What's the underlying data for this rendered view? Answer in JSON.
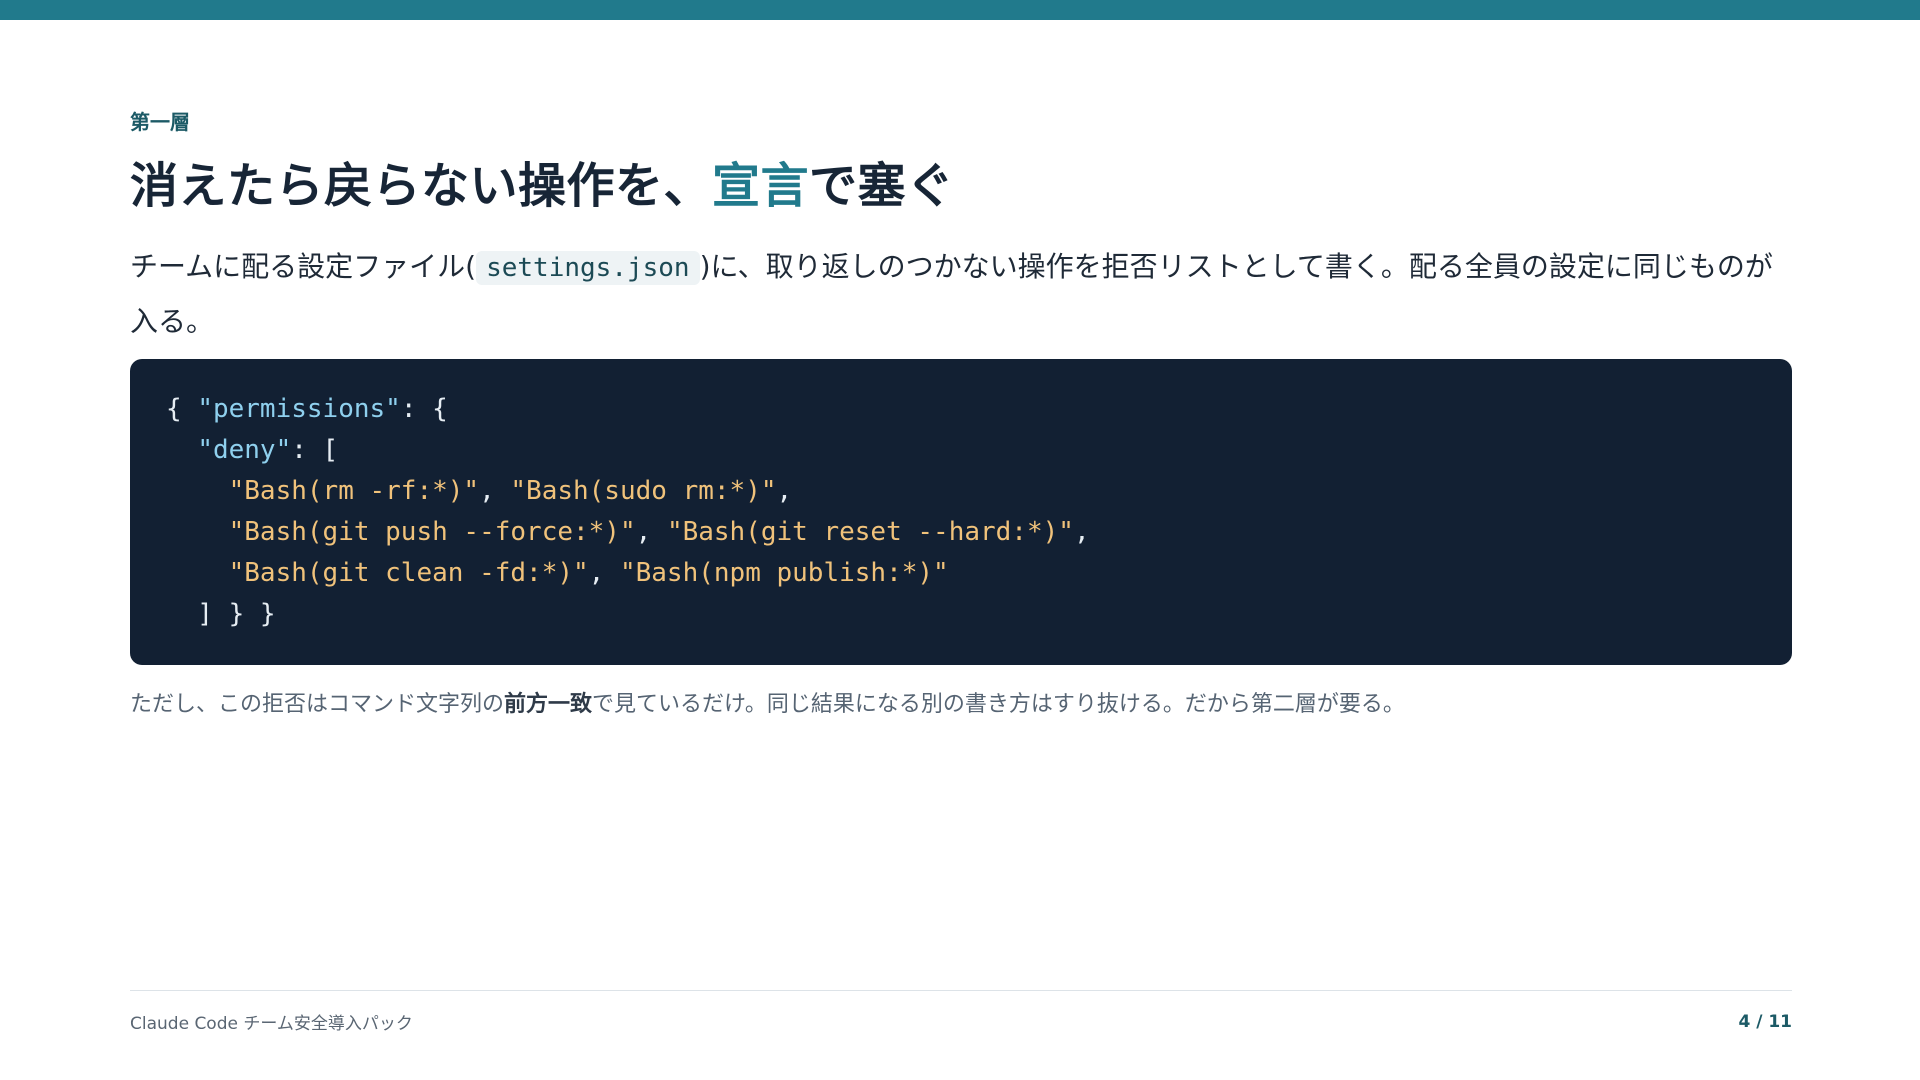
{
  "accent_color": "#217a8c",
  "slide": {
    "eyebrow": "第一層",
    "title_before": "消えたら戻らない操作を、",
    "title_accent": "宣言",
    "title_after": "で塞ぐ",
    "lead_before": "チームに配る設定ファイル(",
    "lead_code": "settings.json",
    "lead_after": ")に、取り返しのつかない操作を拒否リストとして書く。配る全員の設定に同じものが入る。",
    "code": {
      "line1_open": "{ ",
      "line1_key": "\"permissions\"",
      "line1_close": ": {",
      "line2_indent": "  ",
      "line2_key": "\"deny\"",
      "line2_close": ": [",
      "line3_indent": "    ",
      "line3_s1": "\"Bash(rm -rf:*)\"",
      "line3_sep": ", ",
      "line3_s2": "\"Bash(sudo rm:*)\"",
      "line3_end": ",",
      "line4_indent": "    ",
      "line4_s1": "\"Bash(git push --force:*)\"",
      "line4_sep": ", ",
      "line4_s2": "\"Bash(git reset --hard:*)\"",
      "line4_end": ",",
      "line5_indent": "    ",
      "line5_s1": "\"Bash(git clean -fd:*)\"",
      "line5_sep": ", ",
      "line5_s2": "\"Bash(npm publish:*)\"",
      "line6": "  ] } }"
    },
    "note_before": "ただし、この拒否はコマンド文字列の",
    "note_bold": "前方一致",
    "note_after": "で見ているだけ。同じ結果になる別の書き方はすり抜ける。だから第二層が要る。"
  },
  "footer": {
    "deck_title": "Claude Code チーム安全導入パック",
    "page_indicator": "4 / 11"
  }
}
